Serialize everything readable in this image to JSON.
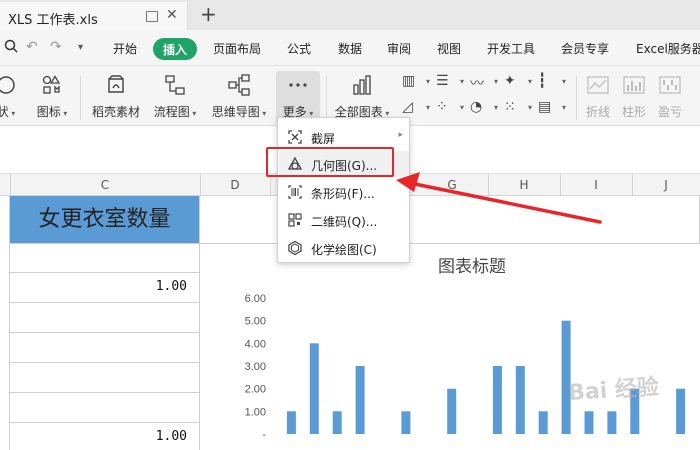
{
  "window": {
    "doc_tab_title": "XLS 工作表.xls"
  },
  "menu": {
    "items": [
      "开始",
      "插入",
      "页面布局",
      "公式",
      "数据",
      "审阅",
      "视图",
      "开发工具",
      "会员专享",
      "Excel服务器"
    ],
    "active": "插入",
    "accent_color": "#20a366"
  },
  "ribbon": {
    "buttons": [
      {
        "label": "状",
        "icon": "shape-icon"
      },
      {
        "label": "图标",
        "icon": "icon-library-icon"
      },
      {
        "label": "稻壳素材",
        "icon": "docer-material-icon"
      },
      {
        "label": "流程图",
        "icon": "flowchart-icon"
      },
      {
        "label": "思维导图",
        "icon": "mindmap-icon"
      },
      {
        "label": "更多",
        "icon": "more-icon"
      },
      {
        "label": "全部图表",
        "icon": "all-charts-icon"
      },
      {
        "label": "折线",
        "icon": "sparkline-line-icon"
      },
      {
        "label": "柱形",
        "icon": "sparkline-column-icon"
      },
      {
        "label": "盈亏",
        "icon": "sparkline-winloss-icon"
      }
    ]
  },
  "more_menu": {
    "items": [
      {
        "label": "截屏",
        "icon": "screenshot-icon",
        "has_submenu": true
      },
      {
        "label": "几何图(G)...",
        "icon": "geometry-icon",
        "highlighted": true
      },
      {
        "label": "条形码(F)...",
        "icon": "barcode-icon"
      },
      {
        "label": "二维码(Q)...",
        "icon": "qrcode-icon"
      },
      {
        "label": "化学绘图(C)",
        "icon": "chemistry-icon"
      }
    ]
  },
  "sheet": {
    "columns": [
      "C",
      "D",
      "G",
      "H",
      "I",
      "J"
    ],
    "header_cell": "女更衣室数量",
    "header_color": "#5b9bd5",
    "values": [
      "",
      "1.00",
      "",
      "",
      "",
      "",
      "1.00"
    ]
  },
  "chart_data": {
    "type": "bar",
    "title": "图表标题",
    "ylim": [
      0,
      6
    ],
    "yticks": [
      "6.00",
      "5.00",
      "4.00",
      "3.00",
      "2.00",
      "1.00",
      "-"
    ],
    "bar_color": "#5b9bd5",
    "series": [
      {
        "values": [
          1,
          4,
          1,
          3,
          0,
          1,
          0,
          2,
          0,
          3,
          3,
          1,
          5,
          1,
          1,
          2,
          0,
          2
        ]
      }
    ]
  },
  "watermark": {
    "text": "Bai 经验"
  }
}
